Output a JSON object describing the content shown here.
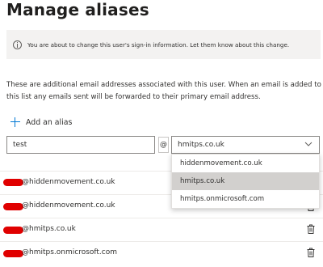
{
  "page": {
    "title": "Manage aliases"
  },
  "info_bar": {
    "message": "You are about to change this user's sign-in information. Let them know about this change."
  },
  "description": "These are additional email addresses associated with this user. When an email is added to this list any emails sent will be forwarded to their primary email address.",
  "add_alias": {
    "label": "Add an alias"
  },
  "alias_input": {
    "value": "test"
  },
  "at_symbol": "@",
  "domain_select": {
    "selected": "hmitps.co.uk",
    "options": [
      {
        "label": "hiddenmovement.co.uk",
        "selected": false
      },
      {
        "label": "hmitps.co.uk",
        "selected": true
      },
      {
        "label": "hmitps.onmicrosoft.com",
        "selected": false
      }
    ]
  },
  "aliases": [
    {
      "email": "@hiddenmovement.co.uk",
      "delete_visible": false
    },
    {
      "email": "@hiddenmovement.co.uk",
      "delete_visible": true
    },
    {
      "email": "@hmitps.co.uk",
      "delete_visible": true
    },
    {
      "email": "@hmitps.onmicrosoft.com",
      "delete_visible": true
    }
  ],
  "colors": {
    "accent": "#0078d4",
    "redaction": "#e00000",
    "selected_option": "#d2d0ce",
    "info_bar": "#f3f2f1"
  },
  "icons": {
    "info": "info-icon",
    "add": "plus-icon",
    "dropdown": "chevron-down-icon",
    "delete": "trash-icon"
  }
}
